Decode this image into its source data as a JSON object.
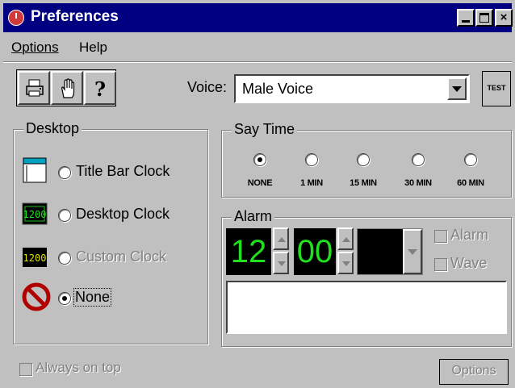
{
  "window": {
    "title": "Preferences"
  },
  "menu": {
    "options": "Options",
    "help": "Help"
  },
  "toolbar": {
    "buttons": [
      {
        "icon": "printer-icon"
      },
      {
        "icon": "hand-icon"
      },
      {
        "icon": "help-icon",
        "glyph": "?"
      }
    ],
    "voice_label": "Voice:",
    "voice_value": "Male Voice",
    "test_label": "TEST"
  },
  "desktop": {
    "title": "Desktop",
    "options": [
      {
        "label": "Title Bar Clock",
        "selected": false,
        "enabled": true,
        "icon": "title-bar-clock-icon"
      },
      {
        "label": "Desktop Clock",
        "selected": false,
        "enabled": true,
        "icon": "desktop-clock-icon",
        "icon_text": "1200"
      },
      {
        "label": "Custom Clock",
        "selected": false,
        "enabled": false,
        "icon": "custom-clock-icon",
        "icon_text": "1200"
      },
      {
        "label": "None",
        "selected": true,
        "enabled": true,
        "icon": "no-entry-icon"
      }
    ]
  },
  "say_time": {
    "title": "Say Time",
    "options": [
      {
        "label": "NONE",
        "selected": true
      },
      {
        "label": "1 MIN",
        "selected": false
      },
      {
        "label": "15 MIN",
        "selected": false
      },
      {
        "label": "30 MIN",
        "selected": false
      },
      {
        "label": "60 MIN",
        "selected": false
      }
    ]
  },
  "alarm": {
    "title": "Alarm",
    "hour": "12",
    "minute": "00",
    "alarm_checkbox": {
      "label": "Alarm",
      "checked": false,
      "enabled": false
    },
    "wave_checkbox": {
      "label": "Wave",
      "checked": false,
      "enabled": false
    },
    "message": ""
  },
  "footer": {
    "always_on_top": {
      "label": "Always on top",
      "checked": false,
      "enabled": false
    },
    "options_button": "Options"
  },
  "colors": {
    "title_bar": "#000080",
    "face": "#c0c0c0",
    "lcd_background": "#000000",
    "lcd_digits": "#20e020"
  }
}
